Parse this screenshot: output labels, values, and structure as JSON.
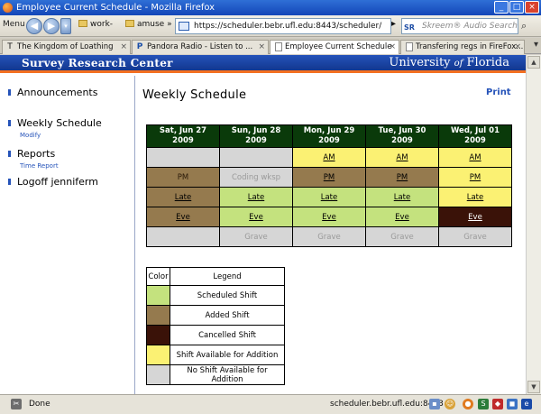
{
  "window": {
    "title": "Employee Current Schedule - Mozilla Firefox"
  },
  "navbar": {
    "menu_label": "Menu",
    "bookmarks": [
      "work-",
      "amuse"
    ],
    "url": "https://scheduler.bebr.ufl.edu:8443/scheduler/",
    "search_placeholder": "Skreem® Audio Search",
    "search_engine": "SR"
  },
  "tabs": [
    {
      "label": "The Kingdom of Loathing",
      "icon": "T",
      "active": false
    },
    {
      "label": "Pandora Radio - Listen to ...",
      "icon": "P",
      "active": false
    },
    {
      "label": "Employee Current Schedule",
      "icon": "",
      "active": true
    },
    {
      "label": "Transfering regs in FireFox...",
      "icon": "",
      "active": false
    }
  ],
  "header": {
    "left_title": "Survey Research Center",
    "right_title_pre": "University ",
    "right_title_of": "of",
    "right_title_post": " Florida"
  },
  "sidebar": {
    "items": [
      {
        "label": "Announcements",
        "sub": ""
      },
      {
        "label": "Weekly Schedule",
        "sub": "Modify"
      },
      {
        "label": "Reports",
        "sub": "Time Report"
      },
      {
        "label": "Logoff jenniferm",
        "sub": ""
      }
    ]
  },
  "main": {
    "title": "Weekly Schedule",
    "print_label": "Print"
  },
  "schedule": {
    "days": [
      {
        "date": "Sat, Jun 27",
        "year": "2009"
      },
      {
        "date": "Sun, Jun 28",
        "year": "2009"
      },
      {
        "date": "Mon, Jun 29",
        "year": "2009"
      },
      {
        "date": "Tue, Jun 30",
        "year": "2009"
      },
      {
        "date": "Wed, Jul 01",
        "year": "2009"
      }
    ],
    "rows": [
      [
        {
          "text": "",
          "status": "none",
          "link": false
        },
        {
          "text": "",
          "status": "none",
          "link": false
        },
        {
          "text": "AM",
          "status": "available",
          "link": true
        },
        {
          "text": "AM",
          "status": "available",
          "link": true
        },
        {
          "text": "AM",
          "status": "available",
          "link": true
        }
      ],
      [
        {
          "text": "PM",
          "status": "added",
          "link": false
        },
        {
          "text": "Coding wksp",
          "status": "none",
          "link": false
        },
        {
          "text": "PM",
          "status": "added",
          "link": true
        },
        {
          "text": "PM",
          "status": "added",
          "link": true
        },
        {
          "text": "PM",
          "status": "available",
          "link": true
        }
      ],
      [
        {
          "text": "Late",
          "status": "added",
          "link": true
        },
        {
          "text": "Late",
          "status": "scheduled",
          "link": true
        },
        {
          "text": "Late",
          "status": "scheduled",
          "link": true
        },
        {
          "text": "Late",
          "status": "scheduled",
          "link": true
        },
        {
          "text": "Late",
          "status": "available",
          "link": true
        }
      ],
      [
        {
          "text": "Eve",
          "status": "added",
          "link": true
        },
        {
          "text": "Eve",
          "status": "scheduled",
          "link": true
        },
        {
          "text": "Eve",
          "status": "scheduled",
          "link": true
        },
        {
          "text": "Eve",
          "status": "scheduled",
          "link": true
        },
        {
          "text": "Eve",
          "status": "cancelled",
          "link": true
        }
      ],
      [
        {
          "text": "",
          "status": "none",
          "link": false
        },
        {
          "text": "Grave",
          "status": "none",
          "link": false
        },
        {
          "text": "Grave",
          "status": "none",
          "link": false
        },
        {
          "text": "Grave",
          "status": "none",
          "link": false
        },
        {
          "text": "Grave",
          "status": "none",
          "link": false
        }
      ]
    ],
    "colors": {
      "scheduled": "#c4e27e",
      "added": "#957a4e",
      "cancelled": "#3a1208",
      "available": "#fbf173",
      "none": "#d6d6d6"
    }
  },
  "legend": {
    "header_color": "Color",
    "header_legend": "Legend",
    "items": [
      {
        "status": "scheduled",
        "label": "Scheduled Shift"
      },
      {
        "status": "added",
        "label": "Added Shift"
      },
      {
        "status": "cancelled",
        "label": "Cancelled Shift"
      },
      {
        "status": "available",
        "label": "Shift Available for Addition"
      },
      {
        "status": "none",
        "label": "No Shift Available for Addition"
      }
    ]
  },
  "statusbar": {
    "status": "Done",
    "url": "scheduler.bebr.ufl.edu:8443"
  }
}
